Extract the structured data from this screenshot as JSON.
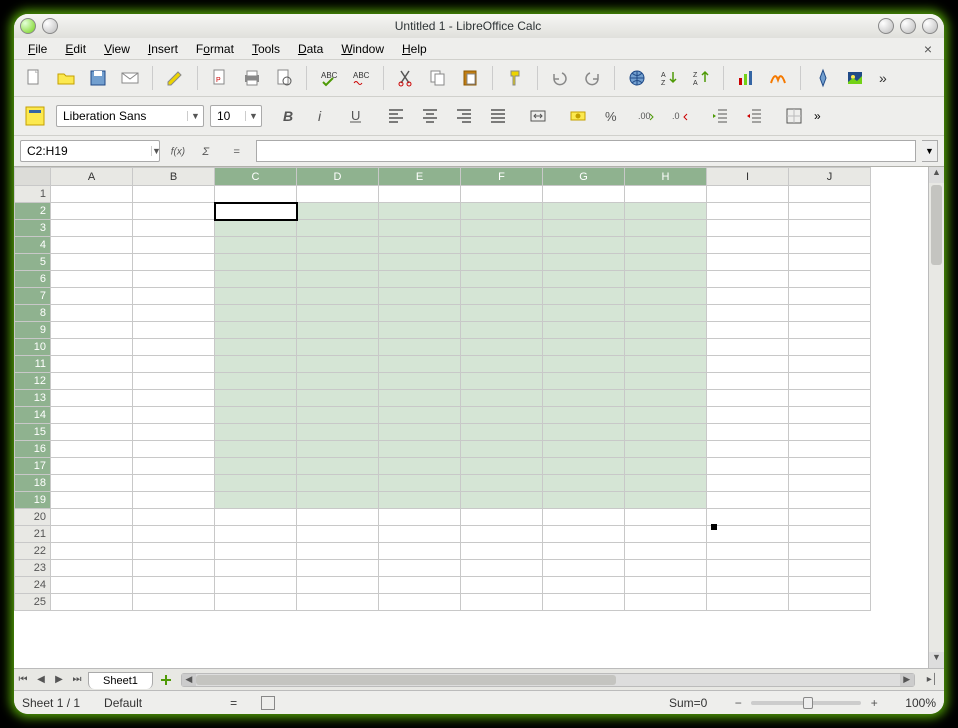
{
  "window": {
    "title": "Untitled 1 - LibreOffice Calc"
  },
  "menu": {
    "file": "File",
    "edit": "Edit",
    "view": "View",
    "insert": "Insert",
    "format": "Format",
    "tools": "Tools",
    "data": "Data",
    "window": "Window",
    "help": "Help"
  },
  "font": {
    "name": "Liberation Sans",
    "size": "10"
  },
  "cellref": {
    "value": "C2:H19"
  },
  "formula": {
    "value": ""
  },
  "columns": [
    "A",
    "B",
    "C",
    "D",
    "E",
    "F",
    "G",
    "H",
    "I",
    "J"
  ],
  "rows": [
    "1",
    "2",
    "3",
    "4",
    "5",
    "6",
    "7",
    "8",
    "9",
    "10",
    "11",
    "12",
    "13",
    "14",
    "15",
    "16",
    "17",
    "18",
    "19",
    "20",
    "21",
    "22",
    "23",
    "24",
    "25"
  ],
  "selection": {
    "startCol": 2,
    "endCol": 7,
    "startRow": 1,
    "endRow": 18,
    "activeCol": 2,
    "activeRow": 1
  },
  "tabs": {
    "sheet1": "Sheet1"
  },
  "status": {
    "sheet": "Sheet 1 / 1",
    "style": "Default",
    "sum": "Sum=0",
    "zoom": "100%"
  }
}
